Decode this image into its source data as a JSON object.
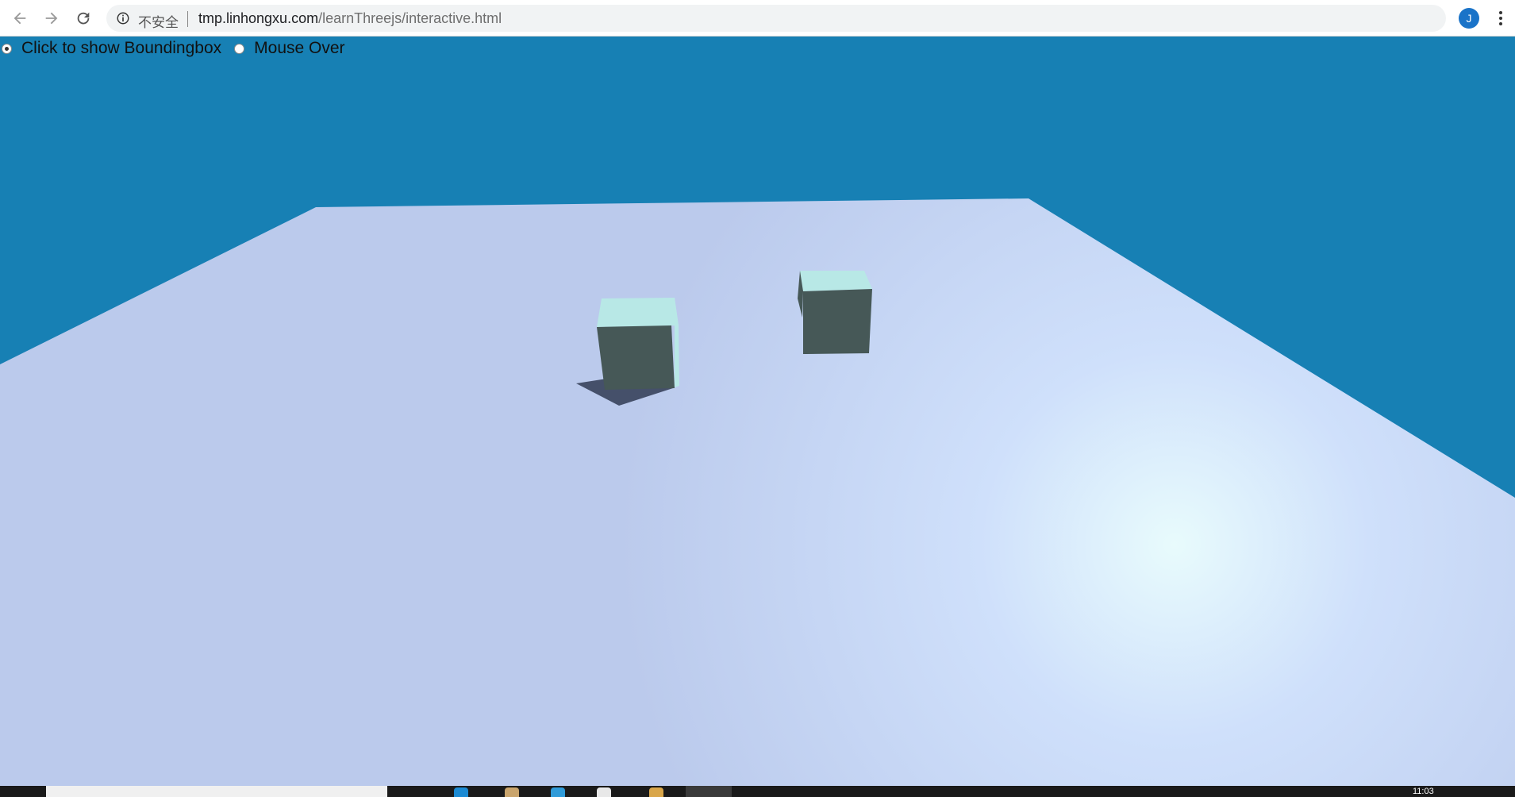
{
  "browser": {
    "security_label": "不安全",
    "url_host": "tmp.linhongxu.com",
    "url_path": "/learnThreejs/interactive.html",
    "profile_initial": "J"
  },
  "controls": {
    "options": [
      {
        "label": "Click to show Boundingbox",
        "checked": true
      },
      {
        "label": "Mouse Over",
        "checked": false
      }
    ]
  },
  "scene": {
    "background_color": "#1780b4",
    "plane_color": "#bbcaec",
    "plane_highlight_color": "#e8fbfc",
    "cube_side_color": "#465857",
    "cube_top_color": "#b8e8e6",
    "shadow_color": "#45506a"
  },
  "taskbar": {
    "clock": "11:03"
  }
}
